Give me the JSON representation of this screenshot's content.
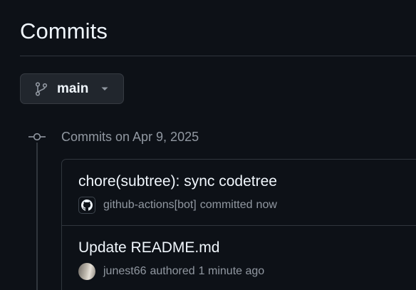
{
  "header": {
    "title": "Commits"
  },
  "branch_selector": {
    "label": "main",
    "icon": "git-branch-icon",
    "chevron": "chevron-down-icon"
  },
  "commit_group": {
    "date_label": "Commits on Apr 9, 2025",
    "commits": [
      {
        "title": "chore(subtree): sync codetree",
        "author": "github-actions[bot]",
        "action": "committed",
        "time": "now",
        "avatar": "github-mark-icon"
      },
      {
        "title": "Update README.md",
        "author": "junest66",
        "action": "authored",
        "time": "1 minute ago",
        "avatar": "user-avatar"
      }
    ]
  },
  "colors": {
    "background": "#0d1117",
    "border": "#30363d",
    "button_bg": "#21262d",
    "text_primary": "#f0f6fc",
    "text_muted": "#9198a1"
  }
}
